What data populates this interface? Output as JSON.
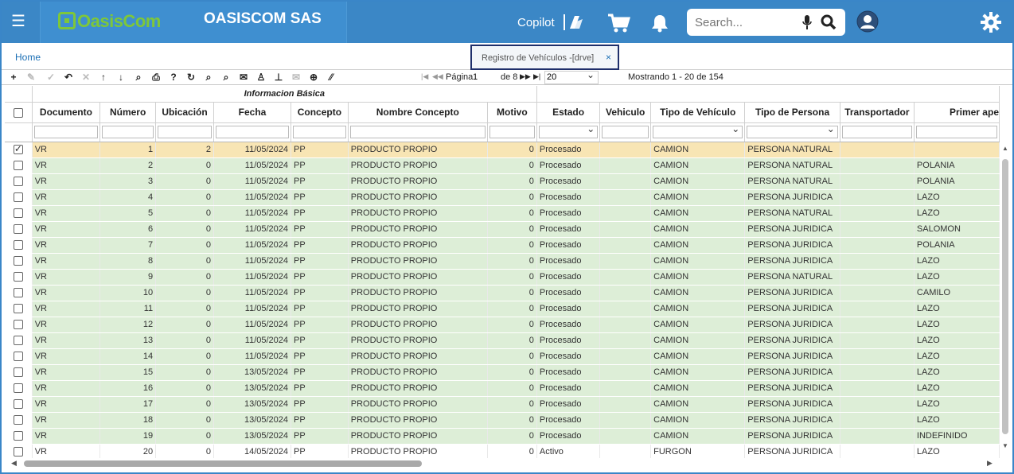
{
  "app": {
    "logo_text": "OasisCom",
    "company": "OASISCOM SAS",
    "copilot_label": "Copilot",
    "search_placeholder": "Search..."
  },
  "nav": {
    "home": "Home",
    "tab_label": "Registro de Vehículos -[drve]",
    "tab_close": "×"
  },
  "toolbar": {
    "buttons": [
      "add",
      "edit",
      "save",
      "undo",
      "delete",
      "move-up",
      "move-down",
      "find",
      "print",
      "help",
      "refresh",
      "zoom-in",
      "zoom-out",
      "comment",
      "user",
      "pin",
      "mail",
      "add-circle",
      "resize"
    ],
    "page_label": "Página",
    "page_value": "1",
    "page_of": "de 8",
    "page_size": "20",
    "status": "Mostrando 1 - 20 de 154"
  },
  "grid": {
    "group_header": "Informacion Básica",
    "columns": [
      "Documento",
      "Número",
      "Ubicación",
      "Fecha",
      "Concepto",
      "Nombre Concepto",
      "Motivo",
      "Estado",
      "Vehiculo",
      "Tipo de Vehículo",
      "Tipo de Persona",
      "Transportador",
      "Primer ape"
    ],
    "rows": [
      {
        "doc": "VR",
        "num": "1",
        "ubic": "2",
        "fecha": "11/05/2024",
        "concepto": "PP",
        "nombre": "PRODUCTO PROPIO",
        "motivo": "0",
        "estado": "Procesado",
        "vehiculo": "",
        "tipo_veh": "CAMION",
        "tipo_per": "PERSONA NATURAL",
        "transp": "",
        "ape": "",
        "checked": true,
        "style": "sel"
      },
      {
        "doc": "VR",
        "num": "2",
        "ubic": "0",
        "fecha": "11/05/2024",
        "concepto": "PP",
        "nombre": "PRODUCTO PROPIO",
        "motivo": "0",
        "estado": "Procesado",
        "vehiculo": "",
        "tipo_veh": "CAMION",
        "tipo_per": "PERSONA NATURAL",
        "transp": "",
        "ape": "POLANIA",
        "checked": false,
        "style": "green"
      },
      {
        "doc": "VR",
        "num": "3",
        "ubic": "0",
        "fecha": "11/05/2024",
        "concepto": "PP",
        "nombre": "PRODUCTO PROPIO",
        "motivo": "0",
        "estado": "Procesado",
        "vehiculo": "",
        "tipo_veh": "CAMION",
        "tipo_per": "PERSONA NATURAL",
        "transp": "",
        "ape": "POLANIA",
        "checked": false,
        "style": "green"
      },
      {
        "doc": "VR",
        "num": "4",
        "ubic": "0",
        "fecha": "11/05/2024",
        "concepto": "PP",
        "nombre": "PRODUCTO PROPIO",
        "motivo": "0",
        "estado": "Procesado",
        "vehiculo": "",
        "tipo_veh": "CAMION",
        "tipo_per": "PERSONA JURIDICA",
        "transp": "",
        "ape": "LAZO",
        "checked": false,
        "style": "green"
      },
      {
        "doc": "VR",
        "num": "5",
        "ubic": "0",
        "fecha": "11/05/2024",
        "concepto": "PP",
        "nombre": "PRODUCTO PROPIO",
        "motivo": "0",
        "estado": "Procesado",
        "vehiculo": "",
        "tipo_veh": "CAMION",
        "tipo_per": "PERSONA NATURAL",
        "transp": "",
        "ape": "LAZO",
        "checked": false,
        "style": "green"
      },
      {
        "doc": "VR",
        "num": "6",
        "ubic": "0",
        "fecha": "11/05/2024",
        "concepto": "PP",
        "nombre": "PRODUCTO PROPIO",
        "motivo": "0",
        "estado": "Procesado",
        "vehiculo": "",
        "tipo_veh": "CAMION",
        "tipo_per": "PERSONA JURIDICA",
        "transp": "",
        "ape": "SALOMON",
        "checked": false,
        "style": "green"
      },
      {
        "doc": "VR",
        "num": "7",
        "ubic": "0",
        "fecha": "11/05/2024",
        "concepto": "PP",
        "nombre": "PRODUCTO PROPIO",
        "motivo": "0",
        "estado": "Procesado",
        "vehiculo": "",
        "tipo_veh": "CAMION",
        "tipo_per": "PERSONA JURIDICA",
        "transp": "",
        "ape": "POLANIA",
        "checked": false,
        "style": "green"
      },
      {
        "doc": "VR",
        "num": "8",
        "ubic": "0",
        "fecha": "11/05/2024",
        "concepto": "PP",
        "nombre": "PRODUCTO PROPIO",
        "motivo": "0",
        "estado": "Procesado",
        "vehiculo": "",
        "tipo_veh": "CAMION",
        "tipo_per": "PERSONA JURIDICA",
        "transp": "",
        "ape": "LAZO",
        "checked": false,
        "style": "green"
      },
      {
        "doc": "VR",
        "num": "9",
        "ubic": "0",
        "fecha": "11/05/2024",
        "concepto": "PP",
        "nombre": "PRODUCTO PROPIO",
        "motivo": "0",
        "estado": "Procesado",
        "vehiculo": "",
        "tipo_veh": "CAMION",
        "tipo_per": "PERSONA NATURAL",
        "transp": "",
        "ape": "LAZO",
        "checked": false,
        "style": "green"
      },
      {
        "doc": "VR",
        "num": "10",
        "ubic": "0",
        "fecha": "11/05/2024",
        "concepto": "PP",
        "nombre": "PRODUCTO PROPIO",
        "motivo": "0",
        "estado": "Procesado",
        "vehiculo": "",
        "tipo_veh": "CAMION",
        "tipo_per": "PERSONA JURIDICA",
        "transp": "",
        "ape": "CAMILO",
        "checked": false,
        "style": "green"
      },
      {
        "doc": "VR",
        "num": "11",
        "ubic": "0",
        "fecha": "11/05/2024",
        "concepto": "PP",
        "nombre": "PRODUCTO PROPIO",
        "motivo": "0",
        "estado": "Procesado",
        "vehiculo": "",
        "tipo_veh": "CAMION",
        "tipo_per": "PERSONA JURIDICA",
        "transp": "",
        "ape": "LAZO",
        "checked": false,
        "style": "green"
      },
      {
        "doc": "VR",
        "num": "12",
        "ubic": "0",
        "fecha": "11/05/2024",
        "concepto": "PP",
        "nombre": "PRODUCTO PROPIO",
        "motivo": "0",
        "estado": "Procesado",
        "vehiculo": "",
        "tipo_veh": "CAMION",
        "tipo_per": "PERSONA JURIDICA",
        "transp": "",
        "ape": "LAZO",
        "checked": false,
        "style": "green"
      },
      {
        "doc": "VR",
        "num": "13",
        "ubic": "0",
        "fecha": "11/05/2024",
        "concepto": "PP",
        "nombre": "PRODUCTO PROPIO",
        "motivo": "0",
        "estado": "Procesado",
        "vehiculo": "",
        "tipo_veh": "CAMION",
        "tipo_per": "PERSONA JURIDICA",
        "transp": "",
        "ape": "LAZO",
        "checked": false,
        "style": "green"
      },
      {
        "doc": "VR",
        "num": "14",
        "ubic": "0",
        "fecha": "11/05/2024",
        "concepto": "PP",
        "nombre": "PRODUCTO PROPIO",
        "motivo": "0",
        "estado": "Procesado",
        "vehiculo": "",
        "tipo_veh": "CAMION",
        "tipo_per": "PERSONA JURIDICA",
        "transp": "",
        "ape": "LAZO",
        "checked": false,
        "style": "green"
      },
      {
        "doc": "VR",
        "num": "15",
        "ubic": "0",
        "fecha": "13/05/2024",
        "concepto": "PP",
        "nombre": "PRODUCTO PROPIO",
        "motivo": "0",
        "estado": "Procesado",
        "vehiculo": "",
        "tipo_veh": "CAMION",
        "tipo_per": "PERSONA JURIDICA",
        "transp": "",
        "ape": "LAZO",
        "checked": false,
        "style": "green"
      },
      {
        "doc": "VR",
        "num": "16",
        "ubic": "0",
        "fecha": "13/05/2024",
        "concepto": "PP",
        "nombre": "PRODUCTO PROPIO",
        "motivo": "0",
        "estado": "Procesado",
        "vehiculo": "",
        "tipo_veh": "CAMION",
        "tipo_per": "PERSONA JURIDICA",
        "transp": "",
        "ape": "LAZO",
        "checked": false,
        "style": "green"
      },
      {
        "doc": "VR",
        "num": "17",
        "ubic": "0",
        "fecha": "13/05/2024",
        "concepto": "PP",
        "nombre": "PRODUCTO PROPIO",
        "motivo": "0",
        "estado": "Procesado",
        "vehiculo": "",
        "tipo_veh": "CAMION",
        "tipo_per": "PERSONA JURIDICA",
        "transp": "",
        "ape": "LAZO",
        "checked": false,
        "style": "green"
      },
      {
        "doc": "VR",
        "num": "18",
        "ubic": "0",
        "fecha": "13/05/2024",
        "concepto": "PP",
        "nombre": "PRODUCTO PROPIO",
        "motivo": "0",
        "estado": "Procesado",
        "vehiculo": "",
        "tipo_veh": "CAMION",
        "tipo_per": "PERSONA JURIDICA",
        "transp": "",
        "ape": "LAZO",
        "checked": false,
        "style": "green"
      },
      {
        "doc": "VR",
        "num": "19",
        "ubic": "0",
        "fecha": "13/05/2024",
        "concepto": "PP",
        "nombre": "PRODUCTO PROPIO",
        "motivo": "0",
        "estado": "Procesado",
        "vehiculo": "",
        "tipo_veh": "CAMION",
        "tipo_per": "PERSONA JURIDICA",
        "transp": "",
        "ape": "INDEFINIDO",
        "checked": false,
        "style": "green"
      },
      {
        "doc": "VR",
        "num": "20",
        "ubic": "0",
        "fecha": "14/05/2024",
        "concepto": "PP",
        "nombre": "PRODUCTO PROPIO",
        "motivo": "0",
        "estado": "Activo",
        "vehiculo": "",
        "tipo_veh": "FURGON",
        "tipo_per": "PERSONA JURIDICA",
        "transp": "",
        "ape": "LAZO",
        "checked": false,
        "style": "white"
      }
    ]
  },
  "colors": {
    "topbar": "#3b87c6",
    "row_green": "#ddeed7",
    "row_selected": "#f8e5b4",
    "tab_border": "#1f2f6b"
  }
}
